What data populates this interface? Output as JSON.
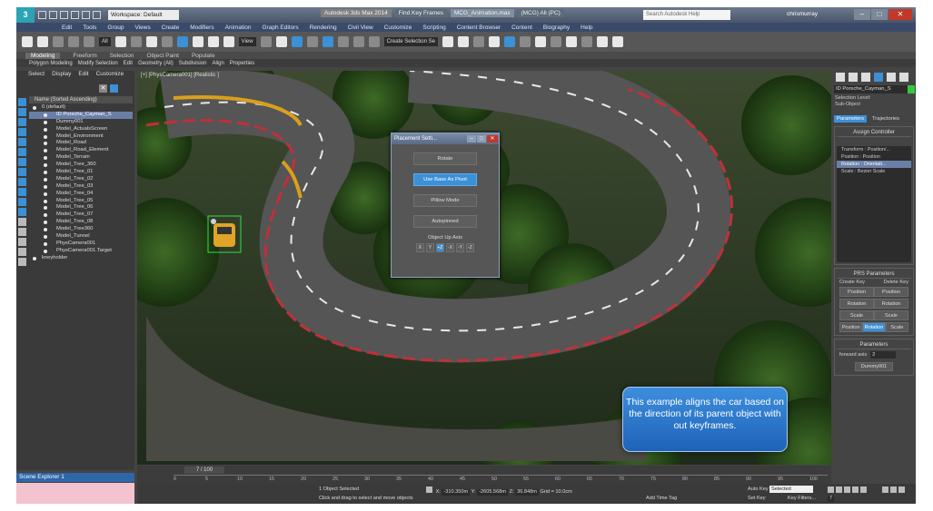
{
  "titlebar": {
    "workspace": "Workspace: Default",
    "title_parts": [
      "Autodesk 3ds Max 2014",
      "Find Key Frames",
      "MCG_Animation.max",
      "(MCG) All (PC)"
    ],
    "search_placeholder": "Search Autodesk Help",
    "user": "chrismurray"
  },
  "menubar": [
    "Edit",
    "Tools",
    "Group",
    "Views",
    "Create",
    "Modifiers",
    "Animation",
    "Graph Editors",
    "Rendering",
    "Civil View",
    "Customize",
    "Scripting",
    "Content Browser",
    "Content",
    "Biography",
    "Help"
  ],
  "toolbar": {
    "filter": "All",
    "view": "View",
    "selection_set": "Create Selection Se"
  },
  "ribbon": {
    "tabs": [
      "Modeling",
      "Freeform",
      "Selection",
      "Object Paint",
      "Populate"
    ],
    "active_tab": "Modeling",
    "sub_items": [
      "Polygon Modeling",
      "Modify Selection",
      "Edit",
      "Geometry (All)",
      "Subdivision",
      "Align",
      "Properties"
    ]
  },
  "scene_explorer": {
    "menu": [
      "Select",
      "Display",
      "Edit",
      "Customize"
    ],
    "header": "Name (Sorted Ascending)",
    "root": "0 (default)",
    "items": [
      {
        "name": "ID Porsche_Cayman_S",
        "selected": true
      },
      {
        "name": "Dummy001",
        "selected": false
      },
      {
        "name": "Model_ActualsScreen",
        "selected": false
      },
      {
        "name": "Model_Environment",
        "selected": false
      },
      {
        "name": "Model_Road",
        "selected": false
      },
      {
        "name": "Model_Road_Element",
        "selected": false
      },
      {
        "name": "Model_Terrain",
        "selected": false
      },
      {
        "name": "Model_Tree_360",
        "selected": false
      },
      {
        "name": "Model_Tree_01",
        "selected": false
      },
      {
        "name": "Model_Tree_02",
        "selected": false
      },
      {
        "name": "Model_Tree_03",
        "selected": false
      },
      {
        "name": "Model_Tree_04",
        "selected": false
      },
      {
        "name": "Model_Tree_05",
        "selected": false
      },
      {
        "name": "Model_Tree_06",
        "selected": false
      },
      {
        "name": "Model_Tree_07",
        "selected": false
      },
      {
        "name": "Model_Tree_08",
        "selected": false
      },
      {
        "name": "Model_Tree360",
        "selected": false
      },
      {
        "name": "Model_Tunnel",
        "selected": false
      },
      {
        "name": "PhysCamera001",
        "selected": false
      },
      {
        "name": "PhysCamera001.Target",
        "selected": false
      }
    ],
    "last_item": "kneyholder",
    "footer": "Scene Explorer 1"
  },
  "viewport": {
    "label": "[+] [PhysCamera001] [Realistic ]"
  },
  "dialog": {
    "title": "Placement Setti...",
    "buttons": [
      "Rotate",
      "Use Base As Pivot",
      "Pillow Mode",
      "Autopinned"
    ],
    "active_button": "Use Base As Pivot",
    "axis_label": "Object Up Axis",
    "axes": [
      "X",
      "Y",
      "+Z",
      "-X",
      "-Y",
      "-Z"
    ],
    "active_axis": "+Z"
  },
  "note": "This example aligns the car based on the direction of its parent object with out keyframes.",
  "command_panel": {
    "object_name": "ID Porsche_Cayman_S",
    "selection_level": "Selection Level:",
    "sub_object": "Sub-Object",
    "tabs": [
      "Parameters",
      "Trajectories"
    ],
    "active_tab": "Parameters",
    "assign_controller": "Assign Controller",
    "controller_tree": [
      {
        "label": "Transform : Position/...",
        "selected": false
      },
      {
        "label": "Position : Position",
        "selected": false
      },
      {
        "label": "Rotation : Orientati...",
        "selected": true
      },
      {
        "label": "Scale : Bezier Scale",
        "selected": false
      }
    ],
    "prs_title": "PRS Parameters",
    "create_key": "Create Key",
    "delete_key": "Delete Key",
    "prs_buttons": [
      "Position",
      "Position",
      "Rotation",
      "Rotation",
      "Scale",
      "Scale"
    ],
    "prs_bottom": [
      "Position",
      "Rotation",
      "Scale"
    ],
    "prs_active": "Rotation",
    "parameters_title": "Parameters",
    "forward_axis_label": "forward axis",
    "forward_axis_value": "2",
    "dummy_button": "Dummy001"
  },
  "timeline": {
    "frame": "7 / 100",
    "ticks": [
      "0",
      "5",
      "10",
      "15",
      "20",
      "25",
      "30",
      "35",
      "40",
      "45",
      "50",
      "55",
      "60",
      "65",
      "70",
      "75",
      "80",
      "85",
      "90",
      "95",
      "100"
    ]
  },
  "status": {
    "selected": "1 Object Selected",
    "hint": "Click and drag to select and move objects",
    "x_label": "X:",
    "x_value": "-310.350m",
    "y_label": "Y:",
    "y_value": "-2605.568m",
    "z_label": "Z:",
    "z_value": "36.848m",
    "grid": "Grid = 10.0cm",
    "add_time_tag": "Add Time Tag",
    "auto_key": "Auto Key",
    "set_key": "Set Key",
    "key_mode": "Selected",
    "key_filters": "Key Filters...",
    "frame_num": "7"
  },
  "colors": {
    "accent": "#3c90d6",
    "note_bg": "#2b76cc",
    "selection": "#6a7fa8"
  }
}
